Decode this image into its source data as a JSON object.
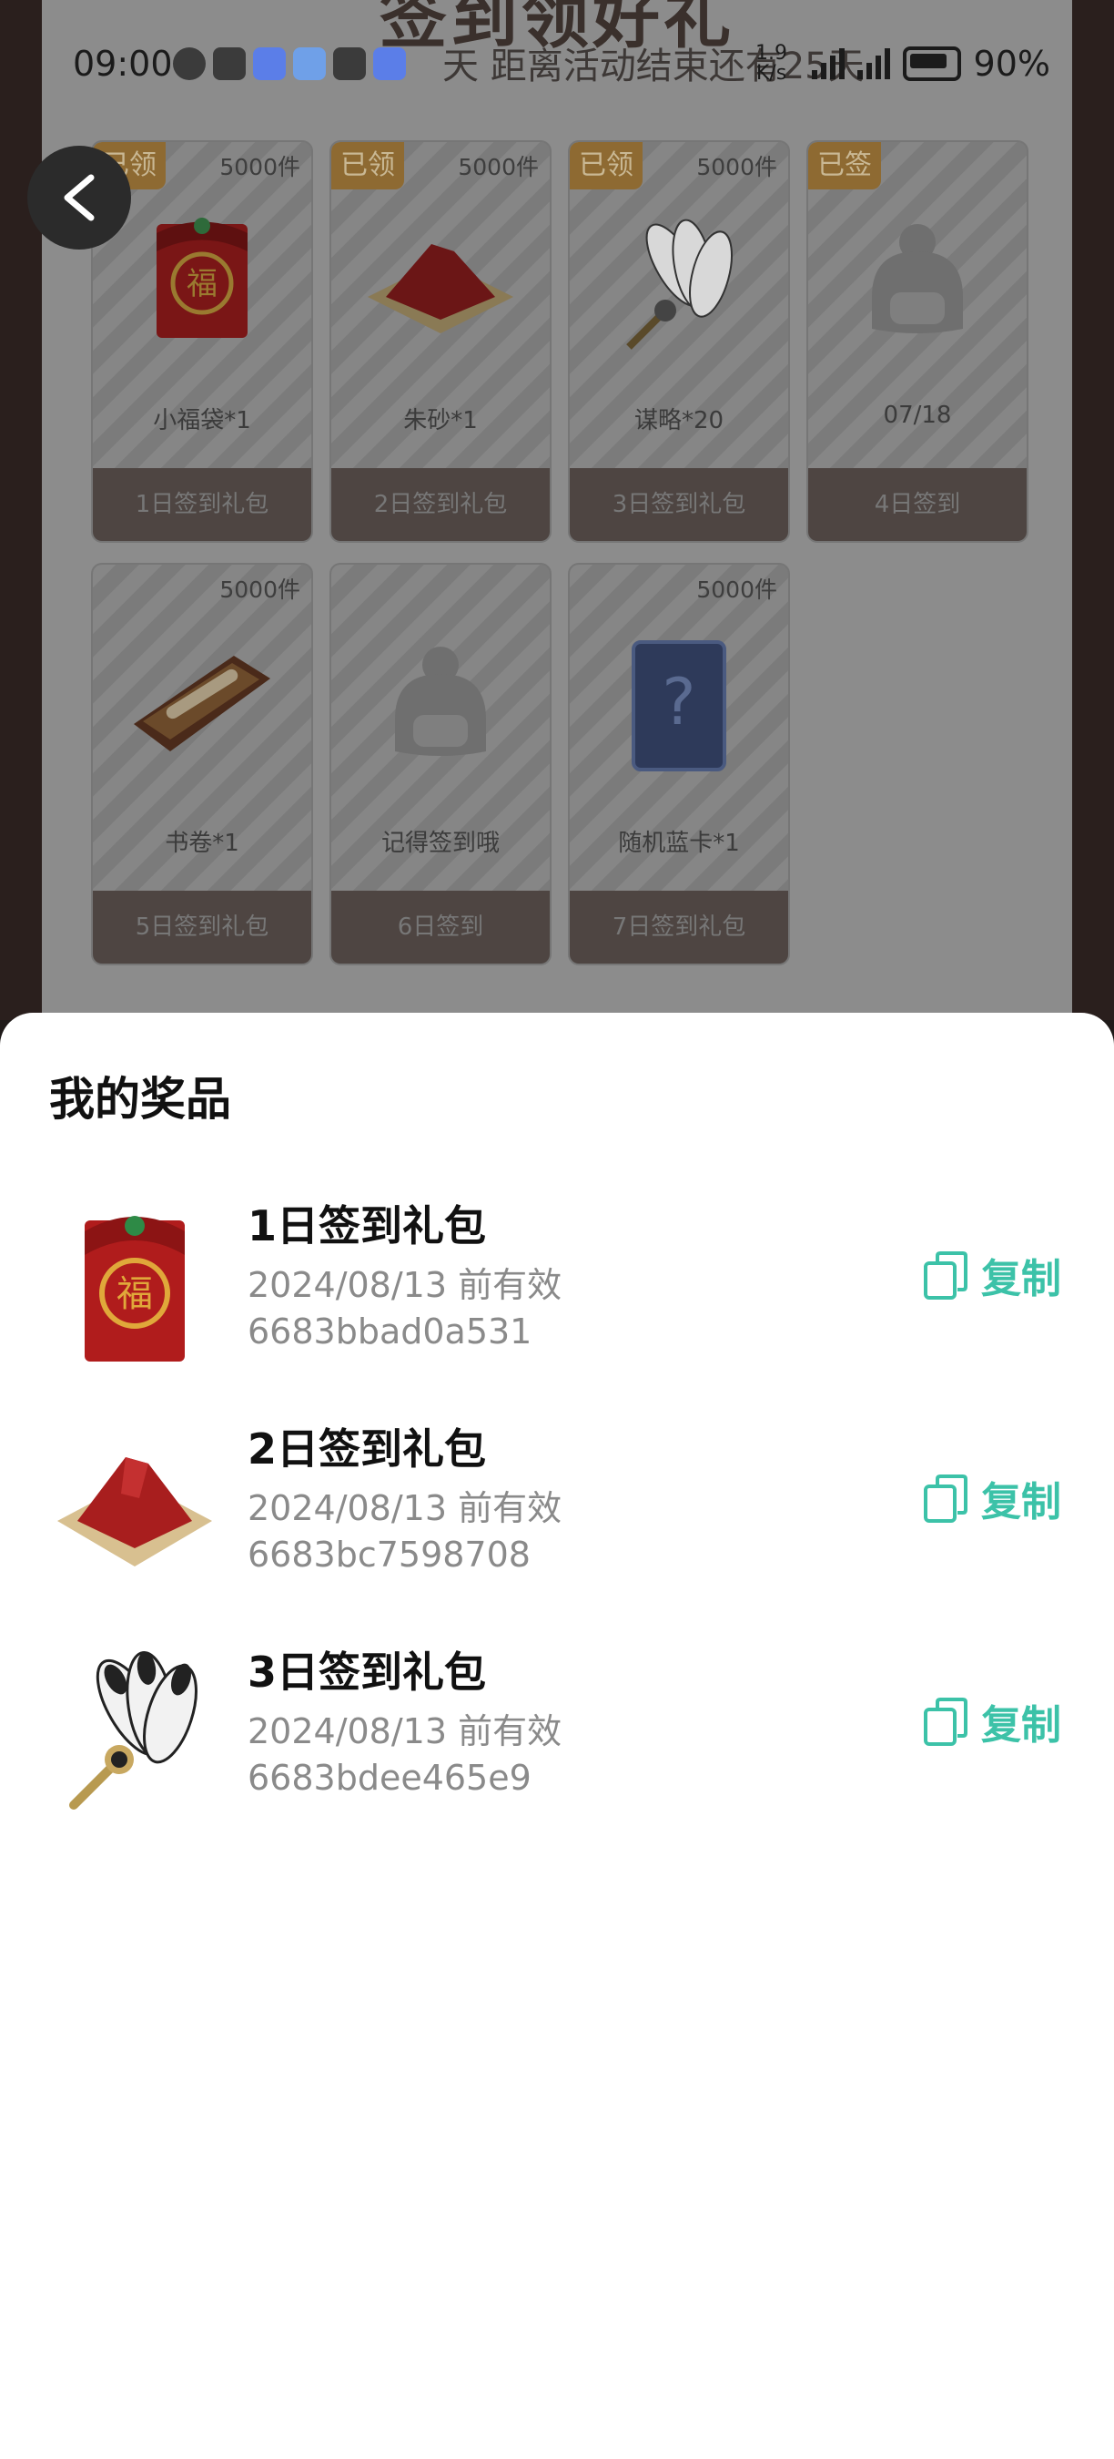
{
  "background": {
    "banner_title": "签到领好礼",
    "banner_subtitle": "天  距离活动结束还有25天",
    "cards": [
      {
        "stock": "5000件",
        "tag": "已领",
        "name": "小福袋*1",
        "footer": "1日签到礼包",
        "icon": "red-envelope-icon"
      },
      {
        "stock": "5000件",
        "tag": "已领",
        "name": "朱砂*1",
        "footer": "2日签到礼包",
        "icon": "cinnabar-icon"
      },
      {
        "stock": "5000件",
        "tag": "已领",
        "name": "谋略*20",
        "footer": "3日签到礼包",
        "icon": "feather-fan-icon"
      },
      {
        "stock": "",
        "tag": "已签",
        "name": "07/18",
        "footer": "4日签到",
        "icon": "mascot-icon"
      },
      {
        "stock": "5000件",
        "tag": "",
        "name": "书卷*1",
        "footer": "5日签到礼包",
        "icon": "scroll-box-icon"
      },
      {
        "stock": "",
        "tag": "",
        "name": "记得签到哦",
        "footer": "6日签到",
        "icon": "mascot-icon"
      },
      {
        "stock": "5000件",
        "tag": "",
        "name": "随机蓝卡*1",
        "footer": "7日签到礼包",
        "icon": "mystery-card-icon"
      }
    ]
  },
  "status_bar": {
    "time": "09:00",
    "net_speed": "1.9 K/s",
    "battery": "90%"
  },
  "sheet": {
    "title": "我的奖品",
    "copy_label": "复制",
    "accent_color": "#3cc2a8",
    "prizes": [
      {
        "name": "1日签到礼包",
        "valid": "2024/08/13 前有效",
        "code": "6683bbad0a531",
        "icon": "red-envelope-icon"
      },
      {
        "name": "2日签到礼包",
        "valid": "2024/08/13 前有效",
        "code": "6683bc7598708",
        "icon": "cinnabar-icon"
      },
      {
        "name": "3日签到礼包",
        "valid": "2024/08/13 前有效",
        "code": "6683bdee465e9",
        "icon": "feather-fan-icon"
      }
    ]
  }
}
